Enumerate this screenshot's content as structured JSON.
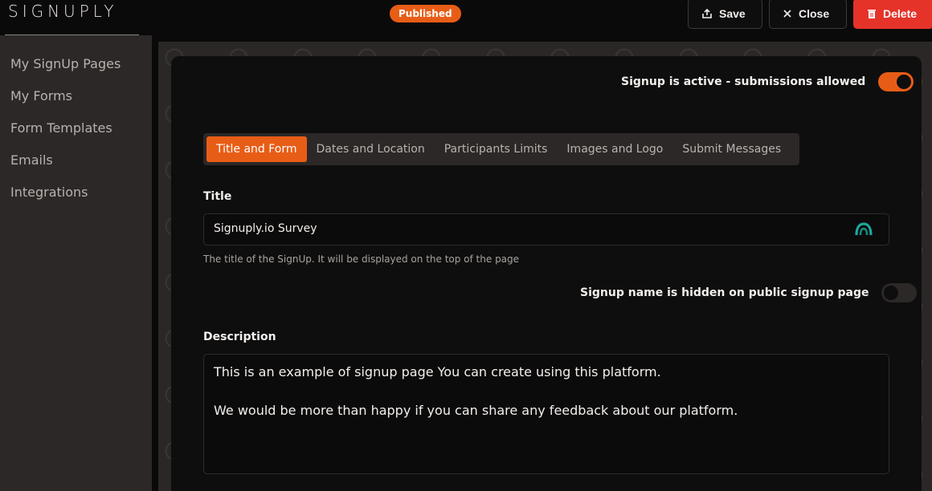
{
  "app": {
    "logo": "SIGNUPLY"
  },
  "sidebar": {
    "items": [
      {
        "label": "My SignUp Pages"
      },
      {
        "label": "My Forms"
      },
      {
        "label": "Form Templates"
      },
      {
        "label": "Emails"
      },
      {
        "label": "Integrations"
      }
    ]
  },
  "header": {
    "status_badge": "Published",
    "save_label": "Save",
    "close_label": "Close",
    "delete_label": "Delete"
  },
  "form": {
    "active_toggle_label": "Signup is active - submissions allowed",
    "active_toggle_on": true,
    "tabs": [
      {
        "label": "Title and Form",
        "active": true
      },
      {
        "label": "Dates and Location",
        "active": false
      },
      {
        "label": "Participants Limits",
        "active": false
      },
      {
        "label": "Images and Logo",
        "active": false
      },
      {
        "label": "Submit Messages",
        "active": false
      }
    ],
    "title_label": "Title",
    "title_value": "Signuply.io Survey",
    "title_hint": "The title of the SignUp. It will be displayed on the top of the page",
    "hidden_toggle_label": "Signup name is hidden on public signup page",
    "hidden_toggle_on": false,
    "description_label": "Description",
    "description_lines": [
      "This is an example of signup page You can create using this platform.",
      "We would be more than happy if you can share any feedback about our platform."
    ]
  },
  "colors": {
    "accent": "#e85d16",
    "danger": "#e5332a",
    "sidebar_bg": "#2b2827",
    "card_bg": "#0f0e0e"
  }
}
